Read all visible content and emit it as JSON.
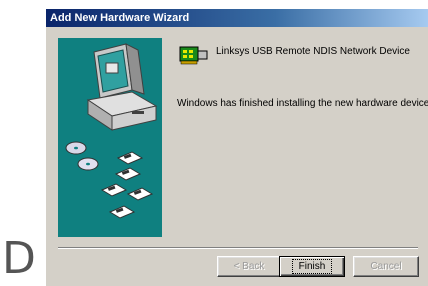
{
  "corner_letter": "D",
  "window": {
    "title": "Add New Hardware Wizard"
  },
  "device": {
    "icon": "network-device-icon",
    "name": "Linksys USB Remote NDIS Network Device"
  },
  "status": {
    "message": "Windows has finished installing the new hardware device."
  },
  "buttons": {
    "back": {
      "label": "< Back",
      "enabled": false
    },
    "finish": {
      "label": "Finish",
      "enabled": true,
      "default": true
    },
    "cancel": {
      "label": "Cancel",
      "enabled": false
    }
  },
  "colors": {
    "title_bar_start": "#0a246a",
    "title_bar_end": "#a6caf0",
    "dialog_face": "#d4d0c8",
    "wizard_art_teal": "#0f8080"
  }
}
